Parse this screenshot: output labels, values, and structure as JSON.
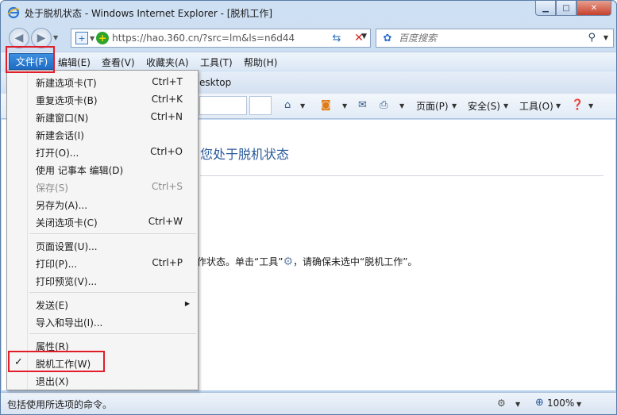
{
  "window": {
    "title": "处于脱机状态 - Windows Internet Explorer - [脱机工作]",
    "minimize_icon": "▁",
    "maximize_icon": "□",
    "close_icon": "✕"
  },
  "address_bar": {
    "url": "https://hao.360.cn/?src=lm&ls=n6d44",
    "security_icon": "shield-icon"
  },
  "search": {
    "placeholder": "百度搜索"
  },
  "menubar": {
    "items": [
      "文件(F)",
      "编辑(E)",
      "查看(V)",
      "收藏夹(A)",
      "工具(T)",
      "帮助(H)"
    ]
  },
  "tabrow": {
    "partial_label": "esktop"
  },
  "command_bar": {
    "page_label": "页面(P)",
    "safety_label": "安全(S)",
    "tools_label": "工具(O)"
  },
  "content": {
    "heading_partial": "您处于脱机状态",
    "para_before": "作状态。单击“工具”",
    "para_after": "，请确保未选中“脱机工作”。"
  },
  "file_menu": {
    "items": [
      {
        "label": "新建选项卡(T)",
        "shortcut": "Ctrl+T"
      },
      {
        "label": "重复选项卡(B)",
        "shortcut": "Ctrl+K"
      },
      {
        "label": "新建窗口(N)",
        "shortcut": "Ctrl+N"
      },
      {
        "label": "新建会话(I)",
        "shortcut": ""
      },
      {
        "label": "打开(O)...",
        "shortcut": "Ctrl+O"
      },
      {
        "label": "使用 记事本 编辑(D)",
        "shortcut": ""
      },
      {
        "label": "保存(S)",
        "shortcut": "Ctrl+S",
        "disabled": true
      },
      {
        "label": "另存为(A)...",
        "shortcut": ""
      },
      {
        "label": "关闭选项卡(C)",
        "shortcut": "Ctrl+W"
      },
      {
        "label": "页面设置(U)...",
        "shortcut": ""
      },
      {
        "label": "打印(P)...",
        "shortcut": "Ctrl+P"
      },
      {
        "label": "打印预览(V)...",
        "shortcut": ""
      },
      {
        "label": "发送(E)",
        "shortcut": "",
        "submenu": true
      },
      {
        "label": "导入和导出(I)...",
        "shortcut": ""
      },
      {
        "label": "属性(R)",
        "shortcut": ""
      },
      {
        "label": "脱机工作(W)",
        "shortcut": "",
        "checked": true
      },
      {
        "label": "退出(X)",
        "shortcut": ""
      }
    ]
  },
  "status_bar": {
    "text": "包括使用所选项的命令。",
    "zoom": "100%"
  },
  "colors": {
    "highlight_box": "#e11d2a",
    "menu_active": "#1f6dc5"
  }
}
